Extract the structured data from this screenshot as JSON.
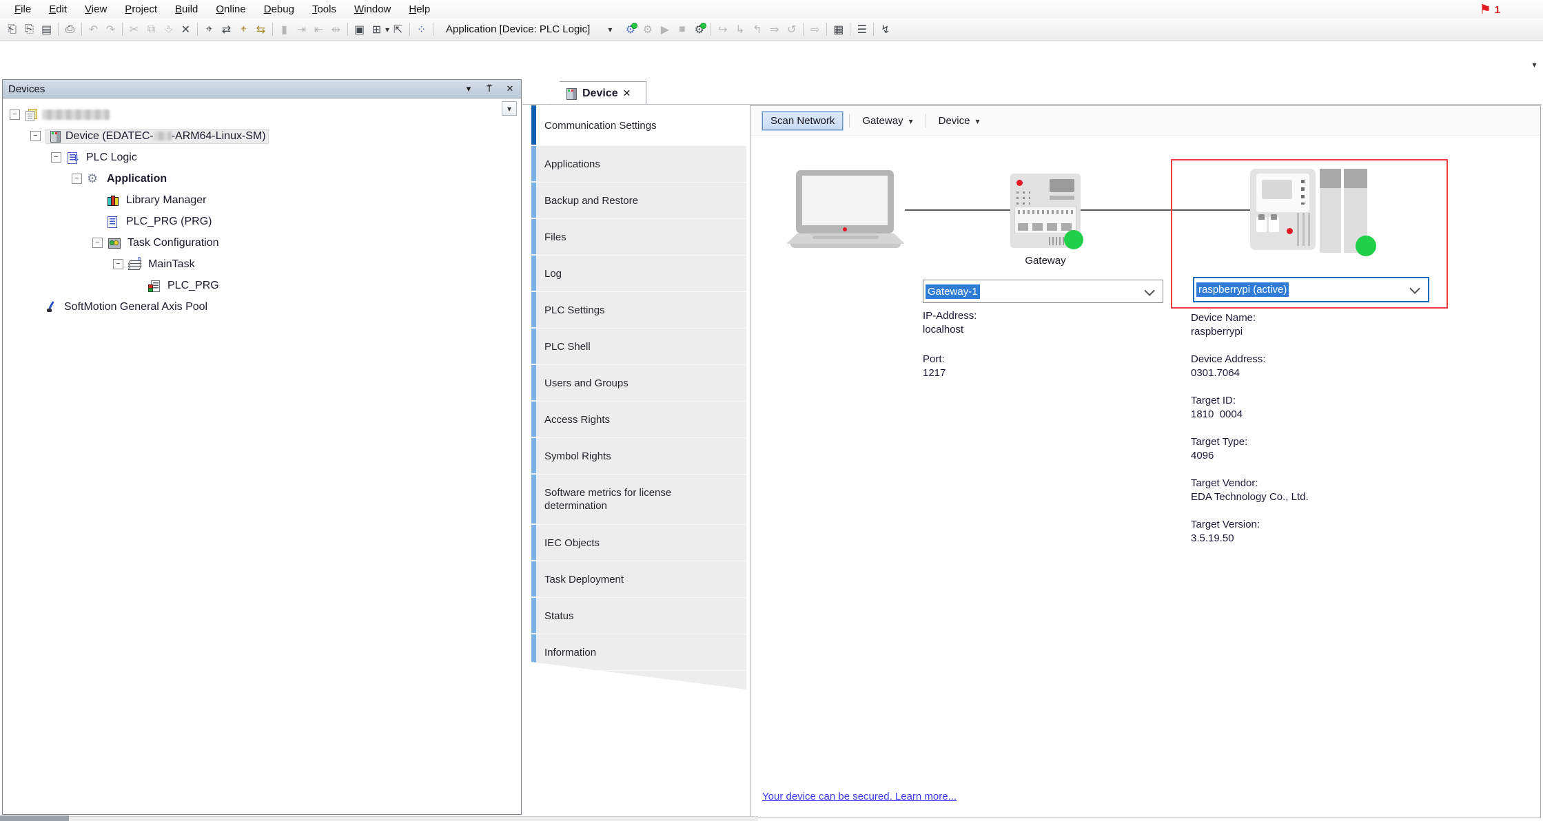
{
  "menu_bar": {
    "items": [
      "File",
      "Edit",
      "View",
      "Project",
      "Build",
      "Online",
      "Debug",
      "Tools",
      "Window",
      "Help"
    ],
    "notification_count": "1"
  },
  "toolbar": {
    "application_selector": "Application [Device: PLC Logic]",
    "icons": [
      {
        "name": "new-project",
        "glyph": "⎗"
      },
      {
        "name": "open-project",
        "glyph": "⎘"
      },
      {
        "name": "save",
        "glyph": "▤"
      },
      {
        "name": "print",
        "glyph": "⎙"
      },
      {
        "name": "undo",
        "glyph": "↶"
      },
      {
        "name": "redo",
        "glyph": "↷"
      },
      {
        "name": "cut",
        "glyph": "✂"
      },
      {
        "name": "copy",
        "glyph": "⧉"
      },
      {
        "name": "paste",
        "glyph": "⎀"
      },
      {
        "name": "delete",
        "glyph": "✕"
      },
      {
        "name": "find",
        "glyph": "⌖"
      },
      {
        "name": "replace",
        "glyph": "⇄"
      },
      {
        "name": "find-in-project",
        "glyph": "⌖"
      },
      {
        "name": "replace-in-project",
        "glyph": "⇆"
      },
      {
        "name": "bookmark",
        "glyph": "▮"
      },
      {
        "name": "bookmark-next",
        "glyph": "⇥"
      },
      {
        "name": "bookmark-prev",
        "glyph": "⇤"
      },
      {
        "name": "bookmark-clear",
        "glyph": "⇹"
      },
      {
        "name": "build",
        "glyph": "▣"
      },
      {
        "name": "new-object",
        "glyph": "⊞"
      },
      {
        "name": "export",
        "glyph": "⇱"
      },
      {
        "name": "watch-grid",
        "glyph": "⁘"
      },
      {
        "name": "login",
        "glyph": "⚙"
      },
      {
        "name": "logout",
        "glyph": "⚙"
      },
      {
        "name": "start",
        "glyph": "▶"
      },
      {
        "name": "stop",
        "glyph": "■"
      },
      {
        "name": "online-config-mode",
        "glyph": "⚙"
      },
      {
        "name": "step-over",
        "glyph": "↪"
      },
      {
        "name": "step-into",
        "glyph": "↳"
      },
      {
        "name": "step-out",
        "glyph": "↰"
      },
      {
        "name": "run-to-cursor",
        "glyph": "⇒"
      },
      {
        "name": "reset",
        "glyph": "↺"
      },
      {
        "name": "next-error",
        "glyph": "⇨"
      },
      {
        "name": "ladder-editor",
        "glyph": "▦"
      },
      {
        "name": "sort-order",
        "glyph": "☰"
      },
      {
        "name": "trace",
        "glyph": "↯"
      }
    ]
  },
  "devices_panel": {
    "title": "Devices",
    "tree": {
      "items": [
        {
          "label": ""
        },
        {
          "label_pre": "Device (EDATEC-",
          "label_post": "-ARM64-Linux-SM)"
        },
        {
          "label": "PLC Logic"
        },
        {
          "label": "Application"
        },
        {
          "label": "Library Manager"
        },
        {
          "label": "PLC_PRG (PRG)"
        },
        {
          "label": "Task Configuration"
        },
        {
          "label": "MainTask"
        },
        {
          "label": "PLC_PRG"
        },
        {
          "label": "SoftMotion General Axis Pool"
        }
      ]
    }
  },
  "document_tabs": {
    "active": "Device"
  },
  "sidebar": {
    "tabs": [
      {
        "label": "Communication Settings"
      },
      {
        "label": "Applications"
      },
      {
        "label": "Backup and Restore"
      },
      {
        "label": "Files"
      },
      {
        "label": "Log"
      },
      {
        "label": "PLC Settings"
      },
      {
        "label": "PLC Shell"
      },
      {
        "label": "Users and Groups"
      },
      {
        "label": "Access Rights"
      },
      {
        "label": "Symbol Rights"
      },
      {
        "label": "Software metrics for license determination"
      },
      {
        "label": "IEC Objects"
      },
      {
        "label": "Task Deployment"
      },
      {
        "label": "Status"
      },
      {
        "label": "Information"
      }
    ]
  },
  "comm": {
    "buttons": {
      "scan_network": "Scan Network",
      "gateway": "Gateway",
      "device": "Device"
    },
    "gateway": {
      "caption": "Gateway",
      "selected": "Gateway-1",
      "ip_label": "IP-Address:",
      "ip": "localhost",
      "port_label": "Port:",
      "port": "1217"
    },
    "target": {
      "selected": "raspberrypi (active)",
      "fields": [
        {
          "label": "Device Name:",
          "value": "raspberrypi"
        },
        {
          "label": "Device Address:",
          "value": "0301.7064"
        },
        {
          "label": "Target ID:",
          "value": "1810  0004"
        },
        {
          "label": "Target Type:",
          "value": "4096"
        },
        {
          "label": "Target Vendor:",
          "value": "EDA Technology Co., Ltd."
        },
        {
          "label": "Target Version:",
          "value": "3.5.19.50"
        }
      ]
    },
    "security_link": "Your device can be secured. Learn more..."
  },
  "colors": {
    "selection_blue": "#2f7cd6",
    "combo_focus_border": "#0f6cbd",
    "highlight_red": "#f23b3b",
    "status_green": "#21d04a",
    "sidebar_accent_active": "#0f5fae",
    "sidebar_accent": "#7ab2e8",
    "link_blue": "#3a3af0"
  }
}
